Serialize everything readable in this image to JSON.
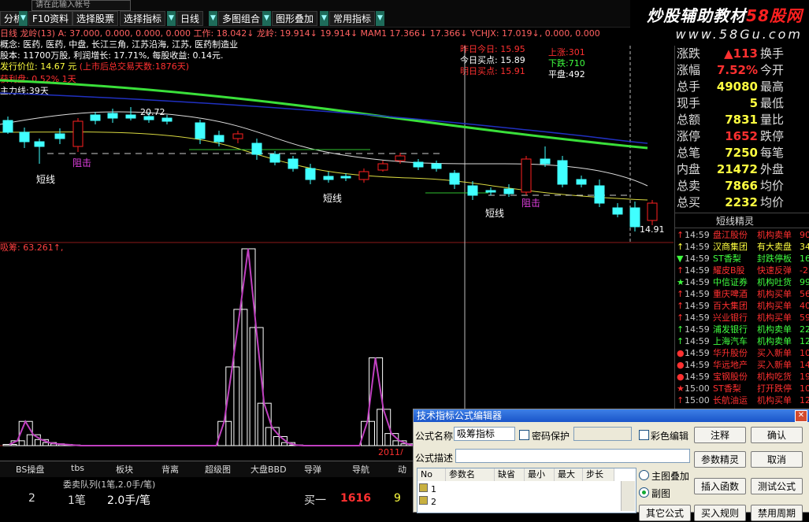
{
  "toolbar": {
    "search_text": "请在此输入帐号",
    "buttons": [
      "分析",
      "F10资料",
      "选择股票",
      "选择指标",
      "日线",
      "多图组合",
      "图形叠加",
      "常用指标"
    ]
  },
  "watermark": {
    "line1_a": "炒股辅助教材",
    "line1_b": "58股网",
    "line2": "www.58Gu.com"
  },
  "info": {
    "line1": "日线  龙岭(13) A: 37.000, 0.000, 0.000, 0.000  工作: 18.042↓  龙岭: 19.914↓ 19.914↓  MAM1  17.366↓  17.366↓  YCHJX: 17.019↓, 0.000, 0.000",
    "line2": "概念: 医药, 医药, 中盘, 长江三角, 江苏沿海, 江苏, 医药制造业",
    "line3": "股本: 11700万股, 利润增长: 17.71%, 每股收益: 0.14元.",
    "line4a": "发行价位: 14.67 元",
    "line4b": "(上市后总交易天数:1876天)",
    "line5": "获利盘: 0.52%  1天",
    "line6": "主力线:39天"
  },
  "price_box": {
    "l1": "昨日今日: 15.95",
    "l2": "今日买点: 15.89",
    "l3": "明日买点: 15.91"
  },
  "updown_box": {
    "up": "上涨:301",
    "down": "下跌:710",
    "flat": "平盘:492"
  },
  "chart_labels": {
    "hi": "20.72",
    "lo": "14.91",
    "duanxian": "短线",
    "zuji": "阻击",
    "indicator": "吸筹: 63.261↑,",
    "date": "2011/"
  },
  "quote": {
    "rows": [
      {
        "l": "涨跌",
        "v": "▲113",
        "l2": "换手",
        "c": "#ff3030"
      },
      {
        "l": "涨幅",
        "v": "7.52%",
        "l2": "今开",
        "c": "#ff3030"
      },
      {
        "l": "总手",
        "v": "49080",
        "l2": "最高",
        "c": "#ffff40"
      },
      {
        "l": "现手",
        "v": "5",
        "l2": "最低",
        "c": "#ffff40"
      },
      {
        "l": "总额",
        "v": "7831",
        "l2": "量比",
        "c": "#ffff40"
      },
      {
        "l": "涨停",
        "v": "1652",
        "l2": "跌停",
        "c": "#ff3030"
      },
      {
        "l": "总笔",
        "v": "7250",
        "l2": "每笔",
        "c": "#ffff40"
      },
      {
        "l": "内盘",
        "v": "21472",
        "l2": "外盘",
        "c": "#ffff40"
      },
      {
        "l": "总卖",
        "v": "7866",
        "l2": "均价",
        "c": "#ffff40"
      },
      {
        "l": "总买",
        "v": "2232",
        "l2": "均价",
        "c": "#ffff40"
      }
    ]
  },
  "panel_tab": "短线精灵",
  "tickers": [
    {
      "m": "↑",
      "t": "14:59",
      "n": "盘江股份",
      "a": "机构卖单",
      "v": "90",
      "c": "#ff3030"
    },
    {
      "m": "↑",
      "t": "14:59",
      "n": "汉商集团",
      "a": "有大卖盘",
      "v": "34",
      "c": "#ffff40"
    },
    {
      "m": "▼",
      "t": "14:59",
      "n": "ST香梨",
      "a": "封跌停板",
      "v": "16",
      "c": "#40ff40"
    },
    {
      "m": "↑",
      "t": "14:59",
      "n": "耀皮B股",
      "a": "快速反弹",
      "v": "-2",
      "c": "#ff3030"
    },
    {
      "m": "★",
      "t": "14:59",
      "n": "中信证券",
      "a": "机构吐货",
      "v": "99",
      "c": "#40ff40"
    },
    {
      "m": "↑",
      "t": "14:59",
      "n": "重庆啤酒",
      "a": "机构买单",
      "v": "56",
      "c": "#ff3030"
    },
    {
      "m": "↑",
      "t": "14:59",
      "n": "百大集团",
      "a": "机构买单",
      "v": "40",
      "c": "#ff3030"
    },
    {
      "m": "↑",
      "t": "14:59",
      "n": "兴业银行",
      "a": "机构买单",
      "v": "59",
      "c": "#ff3030"
    },
    {
      "m": "↑",
      "t": "14:59",
      "n": "浦发银行",
      "a": "机构卖单",
      "v": "22",
      "c": "#40ff40"
    },
    {
      "m": "↑",
      "t": "14:59",
      "n": "上海汽车",
      "a": "机构卖单",
      "v": "12",
      "c": "#40ff40"
    },
    {
      "m": "●",
      "t": "14:59",
      "n": "华升股份",
      "a": "买入新单",
      "v": "10",
      "c": "#ff3030"
    },
    {
      "m": "●",
      "t": "14:59",
      "n": "华远地产",
      "a": "买入新单",
      "v": "14",
      "c": "#ff3030"
    },
    {
      "m": "●",
      "t": "14:59",
      "n": "宝钢股份",
      "a": "机构吃货",
      "v": "19",
      "c": "#ff3030"
    },
    {
      "m": "★",
      "t": "15:00",
      "n": "ST香梨",
      "a": "打开跌停",
      "v": "10",
      "c": "#ff3030"
    },
    {
      "m": "↑",
      "t": "15:00",
      "n": "长航油运",
      "a": "机构买单",
      "v": "12",
      "c": "#ff3030"
    }
  ],
  "bottom_tabs": [
    "BS操盘",
    "tbs",
    "板块",
    "背离",
    "超级图",
    "大盘BBD",
    "导弹",
    "导航",
    "动"
  ],
  "queue": {
    "title": "委卖队列(1笔,2.0手/笔)",
    "c1": "2",
    "c2": "1笔",
    "c3": "2.0手/笔",
    "buy_label": "买一",
    "buy_price": "1616",
    "buy_vol": "9"
  },
  "dialog": {
    "title": "技术指标公式编辑器",
    "name_label": "公式名称",
    "name_value": "吸筹指标",
    "pw_label": "密码保护",
    "color_label": "彩色编辑",
    "desc_label": "公式描述",
    "cols": [
      "No",
      "参数名",
      "缺省",
      "最小",
      "最大",
      "步长"
    ],
    "rows": [
      "1",
      "2"
    ],
    "radio1": "主图叠加",
    "radio2": "副图",
    "btns": [
      "注释",
      "确认",
      "参数精灵",
      "取消",
      "插入函数",
      "测试公式"
    ],
    "bottom_btns": [
      "其它公式",
      "买入规则",
      "禁用周期"
    ]
  },
  "chart_data": {
    "type": "bar",
    "title": "吸筹",
    "values": [
      2,
      8,
      40,
      18,
      10,
      5,
      3,
      2,
      1,
      0,
      0,
      0,
      0,
      0,
      0,
      0,
      0,
      0,
      0,
      0,
      0,
      0,
      0,
      0,
      0,
      0,
      0,
      40,
      130,
      225,
      325,
      195,
      70,
      30,
      15,
      5,
      1,
      0,
      0,
      0,
      0,
      0,
      0,
      0,
      0,
      40,
      145,
      60,
      20,
      8,
      3,
      0
    ]
  }
}
